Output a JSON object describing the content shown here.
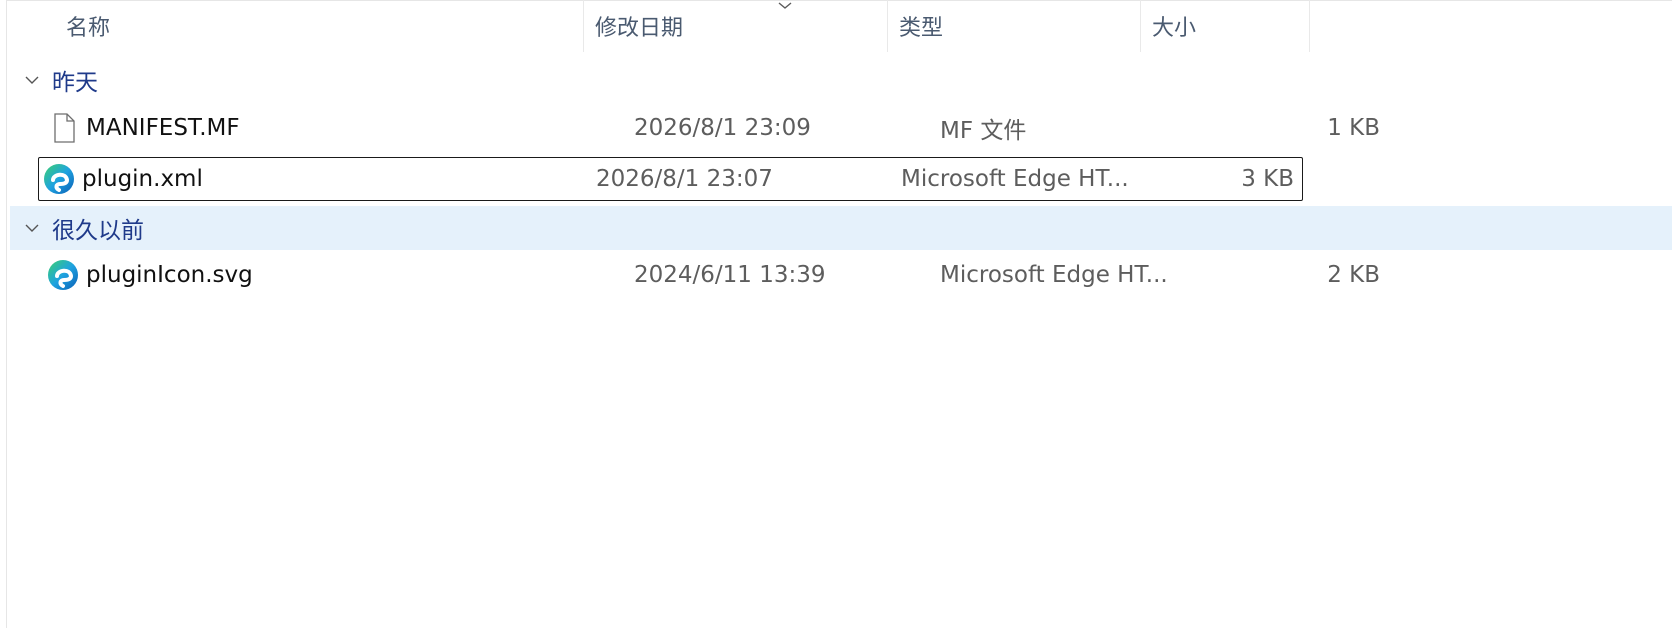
{
  "columns": {
    "name": "名称",
    "date_modified": "修改日期",
    "type": "类型",
    "size": "大小"
  },
  "sort": {
    "column": "date_modified",
    "direction": "descending",
    "icon": "sort-descending-icon"
  },
  "groups": [
    {
      "label": "昨天",
      "expanded": true,
      "files": [
        {
          "name": "MANIFEST.MF",
          "date": "2026/8/1 23:09",
          "type": "MF 文件",
          "size": "1 KB",
          "icon": "generic-file-icon"
        },
        {
          "name": "plugin.xml",
          "date": "2026/8/1 23:07",
          "type": "Microsoft Edge HT...",
          "size": "3 KB",
          "icon": "edge-icon",
          "focused": true
        }
      ]
    },
    {
      "label": "很久以前",
      "expanded": true,
      "highlighted": true,
      "files": [
        {
          "name": "pluginIcon.svg",
          "date": "2024/6/11 13:39",
          "type": "Microsoft Edge HT...",
          "size": "2 KB",
          "icon": "edge-icon"
        }
      ]
    }
  ],
  "colors": {
    "group_label": "#1f3a8a",
    "header_text": "#4a5a70",
    "selection_background": "#e5f1fb",
    "focus_border": "#1a1a1a"
  }
}
